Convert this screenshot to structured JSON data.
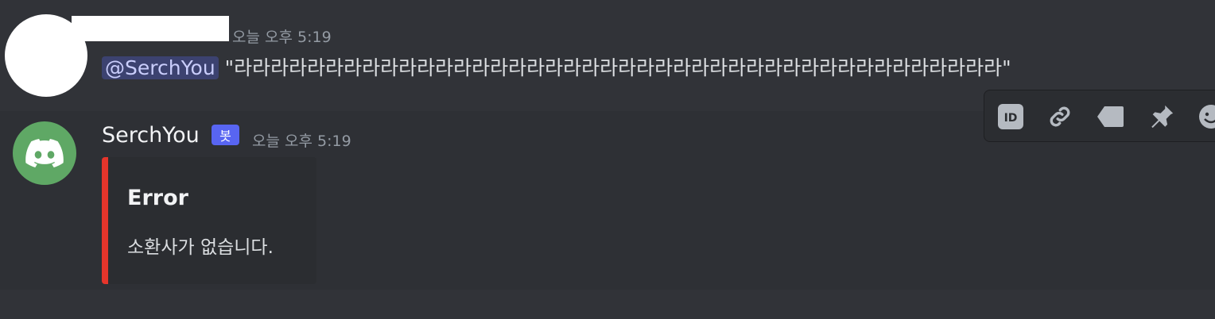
{
  "messages": [
    {
      "timestamp": "오늘 오후 5:19",
      "mention": "@SerchYou",
      "text": "\"라라라라라라라라라라라라라라라라라라라라라라라라라라라라라라라라라라라라라라라라라라\""
    },
    {
      "username": "SerchYou",
      "bot_tag": "봇",
      "timestamp": "오늘 오후 5:19",
      "embed": {
        "color": "#e5352b",
        "title": "Error",
        "description": "소환사가 없습니다."
      }
    }
  ],
  "toolbar": {
    "id_label": "ID",
    "icons": [
      "id-icon",
      "link-icon",
      "tag-icon",
      "pin-icon",
      "emoji-icon"
    ]
  },
  "colors": {
    "background": "#313338",
    "mention_bg": "#3c4270",
    "bot_tag": "#5865f2",
    "bot_avatar": "#5fa865"
  }
}
